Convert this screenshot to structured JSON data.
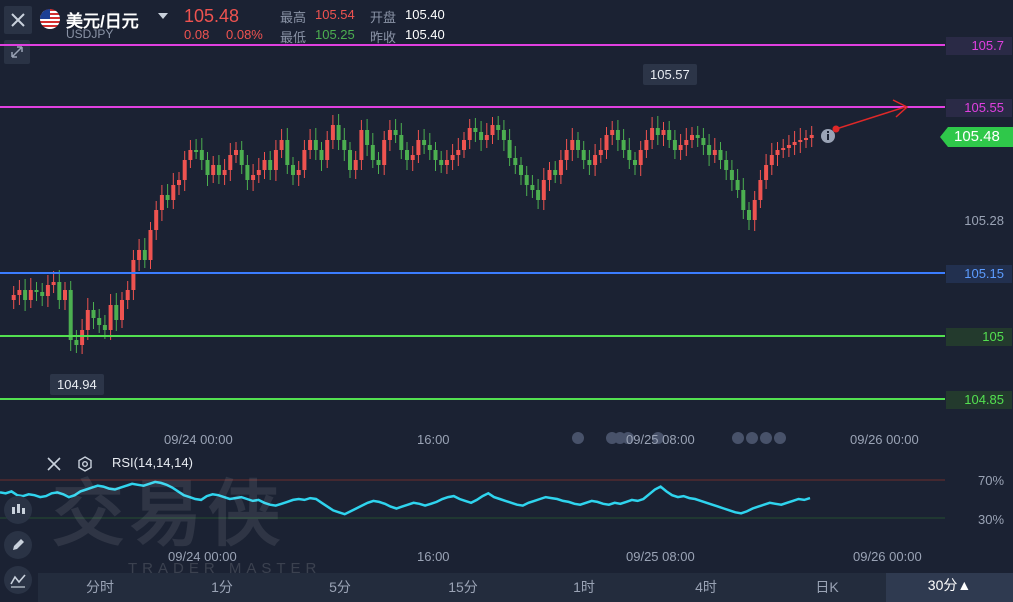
{
  "header": {
    "pair_name": "美元/日元",
    "pair_code": "USDJPY",
    "price": "105.48",
    "change": "0.08",
    "change_pct": "0.08%",
    "high_label": "最高",
    "high": "105.54",
    "low_label": "最低",
    "low": "105.25",
    "open_label": "开盘",
    "open": "105.40",
    "prev_close_label": "昨收",
    "prev_close": "105.40"
  },
  "price_levels": [
    {
      "label": "105.7",
      "color": "#e040e0"
    },
    {
      "label": "105.55",
      "color": "#e040e0"
    },
    {
      "label": "105.48",
      "color": "#2fc84a"
    },
    {
      "label": "105.28",
      "color": "#9aa3b5"
    },
    {
      "label": "105.15",
      "color": "#3b7dff"
    },
    {
      "label": "105",
      "color": "#53e050"
    },
    {
      "label": "104.85",
      "color": "#53e050"
    }
  ],
  "callouts": {
    "high": "105.57",
    "low": "104.94"
  },
  "x_axis_main": [
    "09/24 00:00",
    "16:00",
    "09/25 08:00",
    "09/26 00:00"
  ],
  "x_axis_rsi": [
    "09/24 00:00",
    "16:00",
    "09/25 08:00",
    "09/26 00:00"
  ],
  "rsi": {
    "label": "RSI(14,14,14)",
    "upper": "70%",
    "lower": "30%",
    "values": [
      57,
      56,
      58,
      54,
      53,
      55,
      54,
      52,
      53,
      56,
      57,
      55,
      52,
      54,
      58,
      60,
      62,
      64,
      63,
      61,
      60,
      62,
      64,
      66,
      65,
      64,
      66,
      68,
      67,
      65,
      62,
      58,
      54,
      52,
      50,
      49,
      53,
      55,
      54,
      52,
      50,
      51,
      52,
      50,
      48,
      49,
      46,
      44,
      43,
      45,
      47,
      49,
      50,
      49,
      51,
      50,
      46,
      42,
      38,
      36,
      34,
      37,
      40,
      43,
      46,
      48,
      47,
      45,
      42,
      40,
      42,
      44,
      46,
      45,
      43,
      45,
      47,
      50,
      52,
      53,
      50,
      48,
      46,
      49,
      53,
      56,
      52,
      50,
      48,
      46,
      44,
      43,
      46,
      48,
      50,
      52,
      51,
      50,
      48,
      47,
      45,
      44,
      46,
      48,
      47,
      45,
      44,
      46,
      45,
      47,
      49,
      48,
      50,
      55,
      60,
      63,
      58,
      54,
      52,
      53,
      51,
      50,
      48,
      46,
      44,
      42,
      40,
      38,
      36,
      35,
      37,
      40,
      42,
      44,
      46,
      45,
      44,
      46,
      48,
      50,
      49,
      51
    ]
  },
  "timeframes": [
    "分时",
    "1分",
    "5分",
    "15分",
    "1时",
    "4时",
    "日K",
    "30分▲"
  ],
  "watermark": {
    "cn": "交易侠",
    "en": "TRADER MASTER"
  },
  "colors": {
    "up": "#ef5350",
    "down": "#4caf50",
    "bg": "#1b2233",
    "rsi": "#2fd4ee"
  }
}
